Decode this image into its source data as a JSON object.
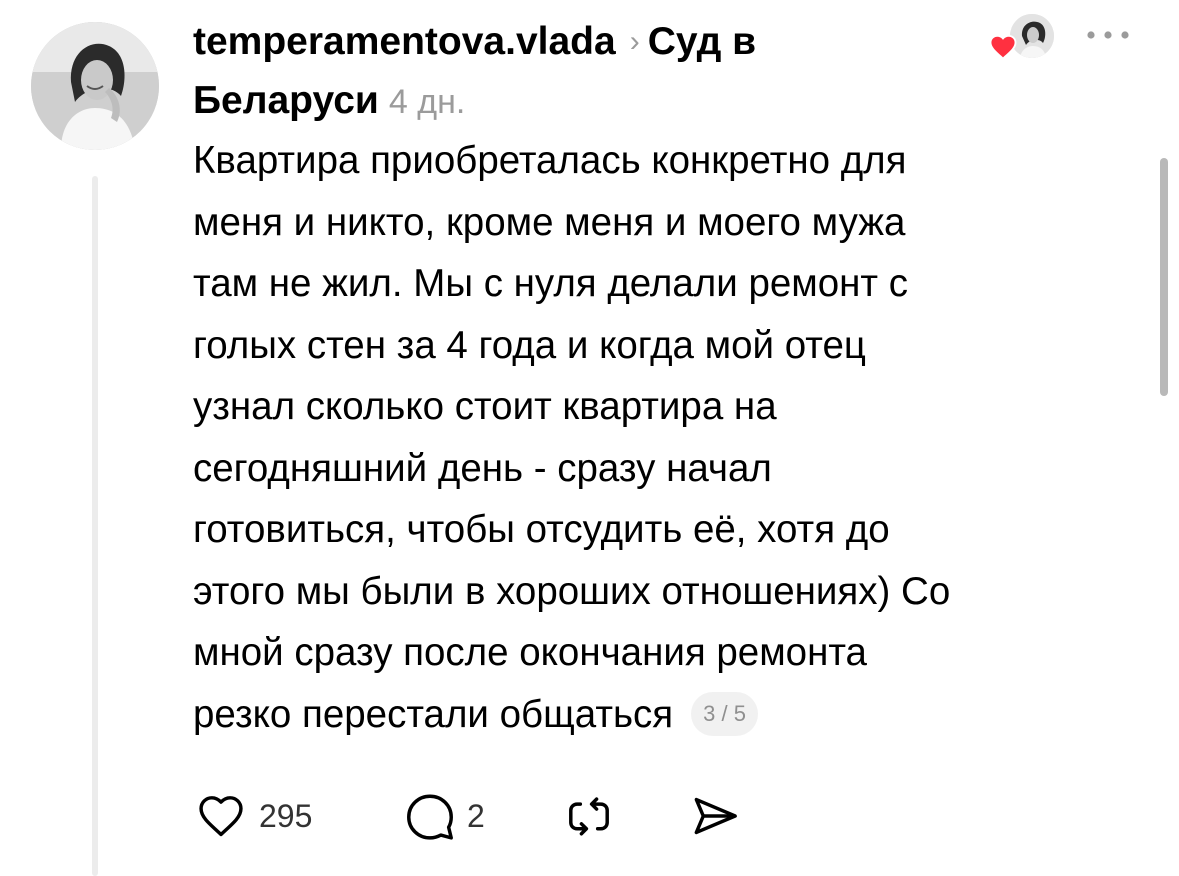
{
  "post": {
    "username": "temperamentova.vlada",
    "community": "Суд в Беларуси",
    "time": "4 дн.",
    "text": "Квартира приобреталась конкретно для\nменя и никто, кроме меня и моего мужа\nтам не жил. Мы с нуля делали ремонт с\nголых стен за 4 года и когда мой отец\nузнал сколько стоит квартира на\nсегодняшний день - сразу начал\nготовиться, чтобы отсудить её, хотя до\nэтого мы были в хороших отношениях) Со\nмной сразу после окончания ремонта\nрезко перестали общаться",
    "page_indicator": "3 / 5"
  },
  "actions": {
    "likes": "295",
    "replies": "2"
  },
  "colors": {
    "heart": "#ff3040",
    "secondary_text": "#9b9b9b",
    "thread_line": "#ececec"
  },
  "icons": {
    "avatar": "avatar",
    "reaction": "heart-icon",
    "more": "more-icon",
    "like": "heart-outline-icon",
    "reply": "comment-icon",
    "repost": "repost-icon",
    "share": "share-icon"
  }
}
